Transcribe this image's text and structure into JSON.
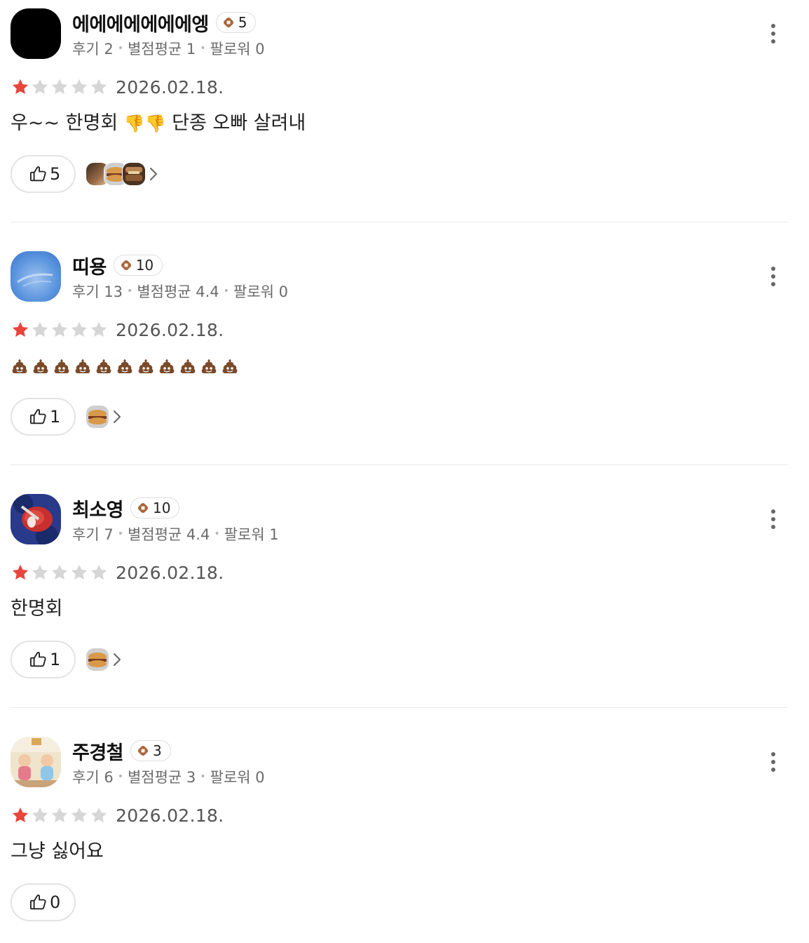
{
  "reviews": [
    {
      "user_name": "에에에에에에에엥",
      "level": "5",
      "avatar_color": "#000000",
      "review_count_label": "후기 2",
      "rating_avg_label": "별점평균 1",
      "follower_label": "팔로워 0",
      "rating": 1,
      "date": "2026.02.18.",
      "text_prefix": "우~~ 한명회 ",
      "text_emoji": "👎👎",
      "text_suffix": " 단종 오빠 살려내",
      "likes": "5",
      "liker_avatars": 3
    },
    {
      "user_name": "띠용",
      "level": "10",
      "avatar_color": "#4a86d4",
      "review_count_label": "후기 13",
      "rating_avg_label": "별점평균 4.4",
      "follower_label": "팔로워 0",
      "rating": 1,
      "date": "2026.02.18.",
      "text_emoji": "💩💩💩💩💩💩💩💩💩💩💩",
      "likes": "1",
      "liker_avatars": 1
    },
    {
      "user_name": "최소영",
      "level": "10",
      "avatar_color": "#c23a3a",
      "review_count_label": "후기 7",
      "rating_avg_label": "별점평균 4.4",
      "follower_label": "팔로워 1",
      "rating": 1,
      "date": "2026.02.18.",
      "text": "한명회",
      "likes": "1",
      "liker_avatars": 1
    },
    {
      "user_name": "주경철",
      "level": "3",
      "avatar_color": "#e8d9b5",
      "review_count_label": "후기 6",
      "rating_avg_label": "별점평균 3",
      "follower_label": "팔로워 0",
      "rating": 1,
      "date": "2026.02.18.",
      "text": "그냥 싫어요",
      "likes": "0",
      "liker_avatars": 0
    }
  ],
  "colors": {
    "star_filled": "#e8453c",
    "star_empty": "#d6d6d6",
    "badge": "#a8663b"
  },
  "icons": [
    "more-vertical-icon",
    "thumbs-up-icon",
    "star-icon",
    "chevron-right-icon",
    "level-badge-icon"
  ]
}
